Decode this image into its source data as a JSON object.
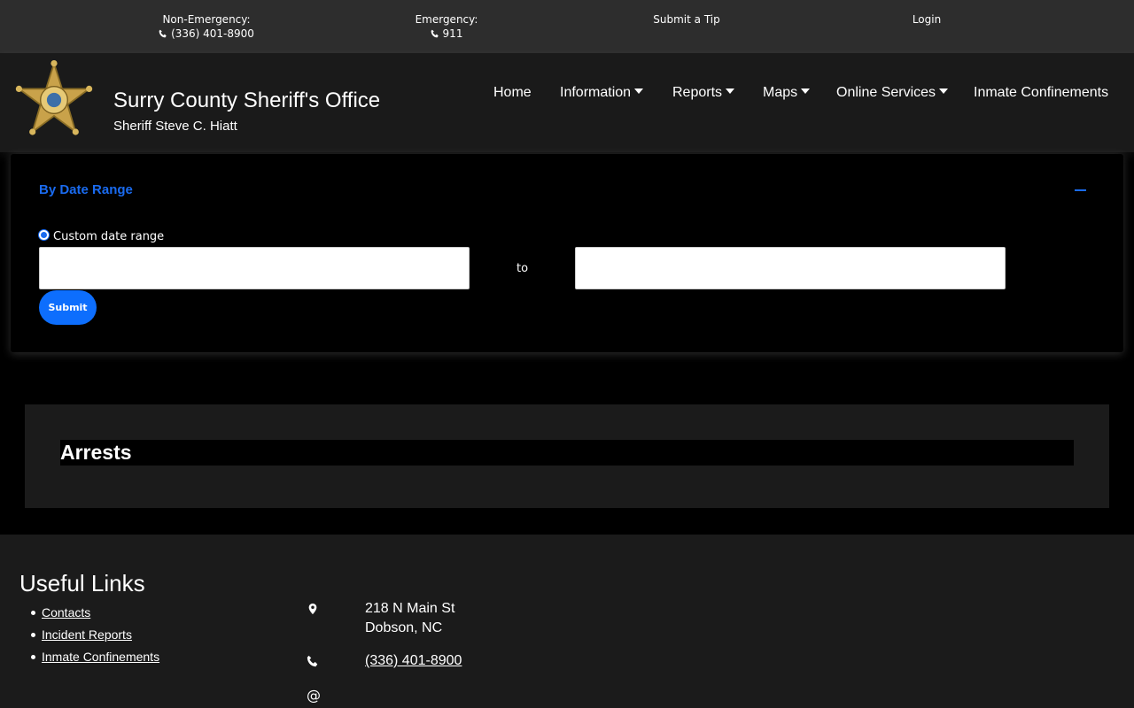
{
  "topbar": {
    "non_emergency_label": "Non-Emergency:",
    "non_emergency_phone": "(336) 401-8900",
    "emergency_label": "Emergency:",
    "emergency_phone": "911",
    "submit_tip": "Submit a Tip",
    "login": "Login"
  },
  "header": {
    "title": "Surry County Sheriff's Office",
    "subtitle": "Sheriff Steve C. Hiatt",
    "badge_icon": "sheriff-star-badge",
    "nav": [
      {
        "label": "Home",
        "dropdown": false
      },
      {
        "label": "Information",
        "dropdown": true
      },
      {
        "label": "Reports",
        "dropdown": true
      },
      {
        "label": "Maps",
        "dropdown": true
      },
      {
        "label": "Online Services",
        "dropdown": true
      },
      {
        "label": "Inmate Confinements",
        "dropdown": false
      }
    ]
  },
  "date_panel": {
    "title": "By Date Range",
    "radio_label": "Custom date range",
    "start_value": "",
    "to_label": "to",
    "end_value": "",
    "submit_label": "Submit",
    "accent": "#1a6bf0"
  },
  "arrests": {
    "title": "Arrests"
  },
  "footer": {
    "links_title": "Useful Links",
    "links": [
      "Contacts",
      "Incident Reports",
      "Inmate Confinements"
    ],
    "address_line1": "218 N Main St",
    "address_line2": "Dobson, NC",
    "phone": "(336) 401-8900",
    "email_symbol": "@"
  }
}
